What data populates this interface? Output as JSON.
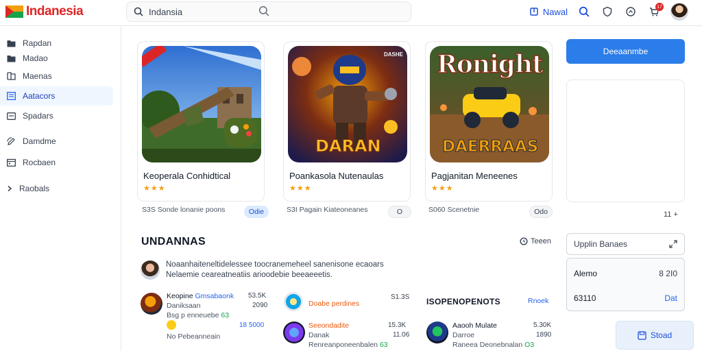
{
  "app": {
    "logo_text": "Indanesia"
  },
  "search": {
    "query": "Indansia"
  },
  "topnav": {
    "link_label": "Nawal",
    "notif_count": "17"
  },
  "sidebar": {
    "items": [
      {
        "label": "Rapdan",
        "icon": "folder-icon"
      },
      {
        "label": "Madao",
        "icon": "folder-icon"
      },
      {
        "label": "Maenas",
        "icon": "book-icon"
      },
      {
        "label": "Aatacors",
        "icon": "list-icon",
        "active": true
      },
      {
        "label": "Spadars",
        "icon": "window-icon"
      },
      {
        "label": "Damdme",
        "icon": "edit-icon"
      },
      {
        "label": "Rocbaen",
        "icon": "calendar-icon"
      },
      {
        "label": "Raobals",
        "icon": "chevron-right-icon"
      }
    ]
  },
  "cards": [
    {
      "title": "Keoperala Conhidtical",
      "stars": "★★★",
      "meta": "S3S Sonde lonanie poons",
      "pill": "Odie",
      "art_text": ""
    },
    {
      "title": "Poankasola Nutenaulas",
      "stars": "★★★",
      "meta": "S3I Pagain Kiateoneanes",
      "pill": "O",
      "art_text": "DARAN",
      "art_tag": "DASHE"
    },
    {
      "title": "Pagjanitan Meneenes",
      "stars": "★★★",
      "meta": "S060 Scenetnie",
      "pill": "Odo",
      "art_title": "Ronight",
      "art_text": "DAERRAAS"
    }
  ],
  "section": {
    "title": "UNDANNAS",
    "link": "Teeen"
  },
  "news": {
    "line1": "Noaanhaiteneltidelessee toocranemeheel sanenisone ecaoars",
    "line2": "Nelaemie ceareatneatiis arioodebie beeaeeetis."
  },
  "list": {
    "col1": [
      {
        "name": "Keopine",
        "name_accent": "Gmsabaonk",
        "sub1": "Daniksaan",
        "sub2": "Bsg p enneuebe",
        "sub2_accent": "63",
        "sub3": "No Pebeanneain",
        "num1": "53.5K",
        "num2": "2090",
        "num3": "18 5000"
      },
      {
        "name": "",
        "sub1": "",
        "sub2": "",
        "num1": "",
        "num2": "",
        "num3": ""
      }
    ],
    "col2": [
      {
        "name": "Doabe perdines",
        "num1": "S1.3S"
      },
      {
        "name": "Seeondadite",
        "sub1": "Danak",
        "sub2": "Renreanponeenbalen",
        "sub2_accent": "63",
        "num1": "15.3K",
        "num2": "11.06"
      }
    ],
    "col3_header": "ISOPENOPENOTS",
    "col3_link": "Rnoek",
    "col3": [
      {
        "name": "Aaooh Mulate",
        "sub1": "Darroe",
        "sub2": "Raneea Deonebnalan",
        "sub2_accent": "O3",
        "num1": "5.30K",
        "num2": "1890"
      }
    ]
  },
  "right": {
    "button": "Deeaanmbe",
    "small": "11 +",
    "input_label": "Upplin Banaes",
    "box_label1": "Alemo",
    "box_value1": "8 2I0",
    "box_label2": "63110",
    "box_value2": "Dat",
    "float_button": "Stoad"
  }
}
